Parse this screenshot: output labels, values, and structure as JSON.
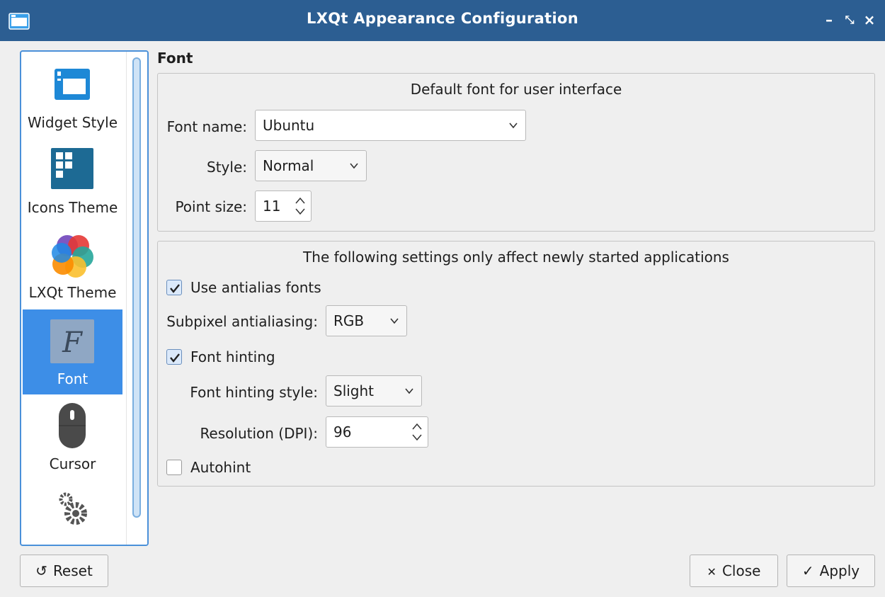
{
  "window": {
    "title": "LXQt Appearance Configuration",
    "buttons": {
      "minimize": "–",
      "restore": "⤡",
      "close": "×"
    }
  },
  "sidebar": {
    "items": [
      {
        "label": "Widget Style",
        "icon": "widget-style-icon"
      },
      {
        "label": "Icons Theme",
        "icon": "icons-theme-icon"
      },
      {
        "label": "LXQt Theme",
        "icon": "lxqt-theme-icon"
      },
      {
        "label": "Font",
        "icon": "font-icon",
        "selected": true
      },
      {
        "label": "Cursor",
        "icon": "cursor-icon"
      },
      {
        "label": "",
        "icon": "settings-gears-icon"
      }
    ]
  },
  "page": {
    "title": "Font",
    "default_font": {
      "heading": "Default font for user interface",
      "font_name_label": "Font name:",
      "font_name_value": "Ubuntu",
      "style_label": "Style:",
      "style_value": "Normal",
      "point_size_label": "Point size:",
      "point_size_value": "11"
    },
    "new_apps": {
      "heading": "The following settings only affect newly started applications",
      "antialias_label": "Use antialias fonts",
      "antialias_checked": true,
      "subpixel_label": "Subpixel antialiasing:",
      "subpixel_value": "RGB",
      "hinting_label": "Font hinting",
      "hinting_checked": true,
      "hinting_style_label": "Font hinting style:",
      "hinting_style_value": "Slight",
      "dpi_label": "Resolution (DPI):",
      "dpi_value": "96",
      "autohint_label": "Autohint",
      "autohint_checked": false
    }
  },
  "footer": {
    "reset_label": "Reset",
    "close_label": "Close",
    "apply_label": "Apply"
  },
  "colors": {
    "titlebar": "#2c5e92",
    "selection": "#3d8ee7",
    "accent_border": "#4a90d9"
  }
}
